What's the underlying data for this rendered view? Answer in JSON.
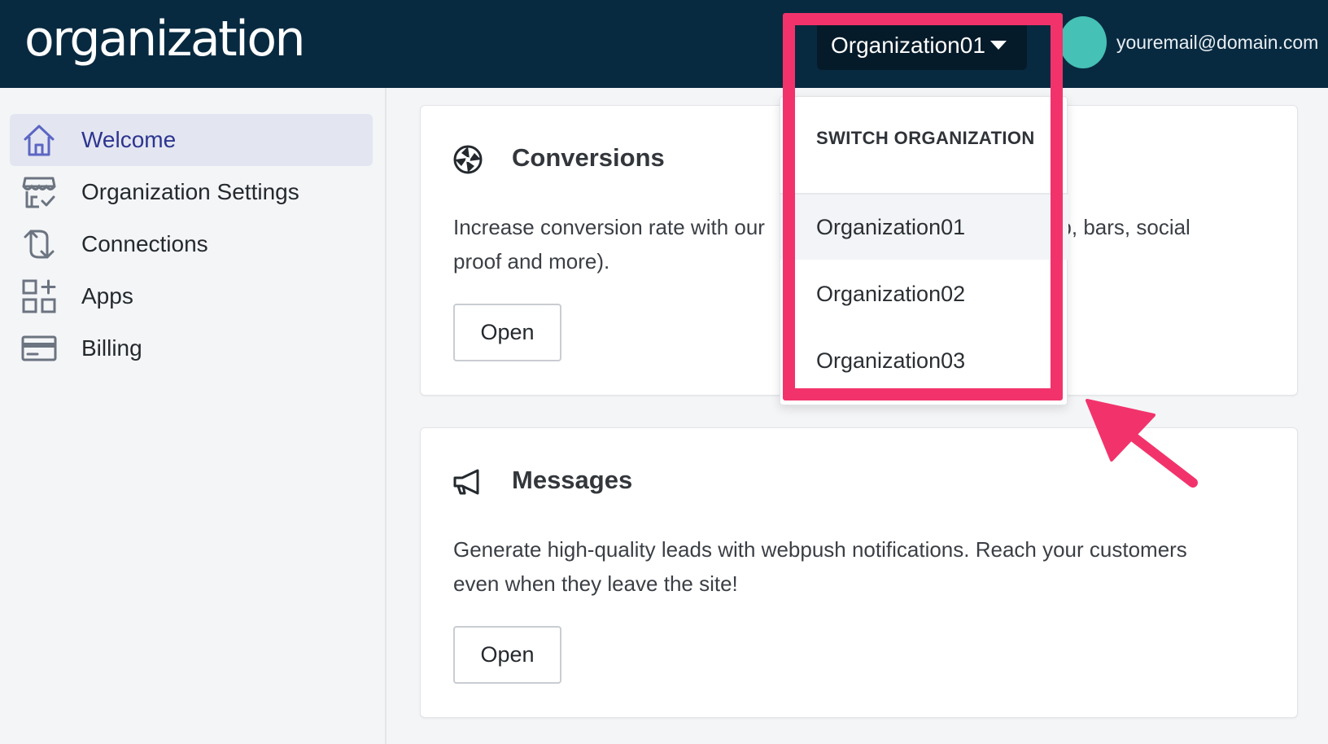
{
  "header": {
    "logo_text": "organization",
    "org_selector": {
      "current": "Organization01",
      "icon": "caret-down-icon"
    },
    "user": {
      "email": "youremail@domain.com",
      "avatar_color": "#45c1b5"
    }
  },
  "sidebar": {
    "items": [
      {
        "label": "Welcome",
        "icon": "home-icon",
        "active": true
      },
      {
        "label": "Organization Settings",
        "icon": "store-settings-icon",
        "active": false
      },
      {
        "label": "Connections",
        "icon": "sync-icon",
        "active": false
      },
      {
        "label": "Apps",
        "icon": "apps-add-icon",
        "active": false
      },
      {
        "label": "Billing",
        "icon": "credit-card-icon",
        "active": false
      }
    ]
  },
  "cards": [
    {
      "title": "Conversions",
      "icon": "aperture-icon",
      "description_prefix": "Increase conversion rate with our",
      "description_suffix": "op, bars, social",
      "description_line2": "proof and more).",
      "button_label": "Open"
    },
    {
      "title": "Messages",
      "icon": "megaphone-icon",
      "description_line1": "Generate high-quality leads with webpush notifications. Reach your customers",
      "description_line2": "even when they leave the site!",
      "button_label": "Open"
    }
  ],
  "org_dropdown": {
    "header": "SWITCH ORGANIZATION",
    "options": [
      "Organization01",
      "Organization02",
      "Organization03"
    ],
    "selected_index": 0
  },
  "colors": {
    "header_bg": "#082a40",
    "accent": "#2d3590",
    "highlight": "#f2336b",
    "avatar": "#45c1b5"
  }
}
